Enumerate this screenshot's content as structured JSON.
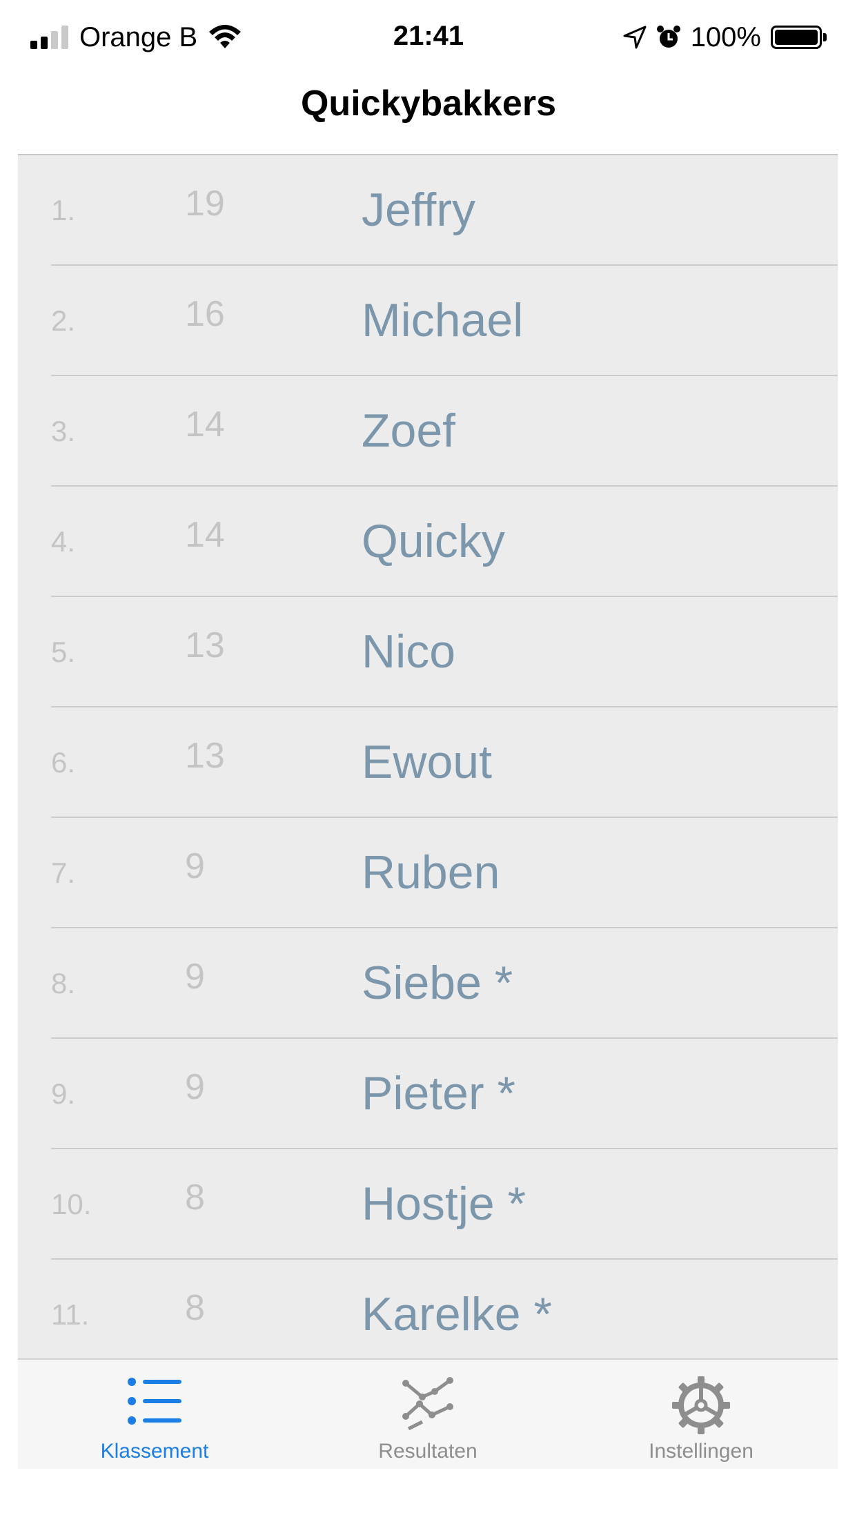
{
  "status": {
    "carrier": "Orange B",
    "time": "21:41",
    "battery": "100%"
  },
  "nav": {
    "title": "Quickybakkers"
  },
  "rows": [
    {
      "rank": "1.",
      "score": "19",
      "name": "Jeffry"
    },
    {
      "rank": "2.",
      "score": "16",
      "name": "Michael"
    },
    {
      "rank": "3.",
      "score": "14",
      "name": "Zoef"
    },
    {
      "rank": "4.",
      "score": "14",
      "name": "Quicky"
    },
    {
      "rank": "5.",
      "score": "13",
      "name": "Nico"
    },
    {
      "rank": "6.",
      "score": "13",
      "name": "Ewout"
    },
    {
      "rank": "7.",
      "score": "9",
      "name": "Ruben"
    },
    {
      "rank": "8.",
      "score": "9",
      "name": "Siebe *"
    },
    {
      "rank": "9.",
      "score": "9",
      "name": "Pieter *"
    },
    {
      "rank": "10.",
      "score": "8",
      "name": "Hostje *"
    },
    {
      "rank": "11.",
      "score": "8",
      "name": "Karelke *"
    }
  ],
  "tabs": [
    {
      "label": "Klassement",
      "icon": "list-icon",
      "active": true
    },
    {
      "label": "Resultaten",
      "icon": "chart-line-icon",
      "active": false
    },
    {
      "label": "Instellingen",
      "icon": "gear-icon",
      "active": false
    }
  ],
  "colors": {
    "accent": "#1b7ee6",
    "name_text": "#7c97ab",
    "muted_text": "#c4c4c4",
    "tab_inactive": "#8e8e8e"
  }
}
